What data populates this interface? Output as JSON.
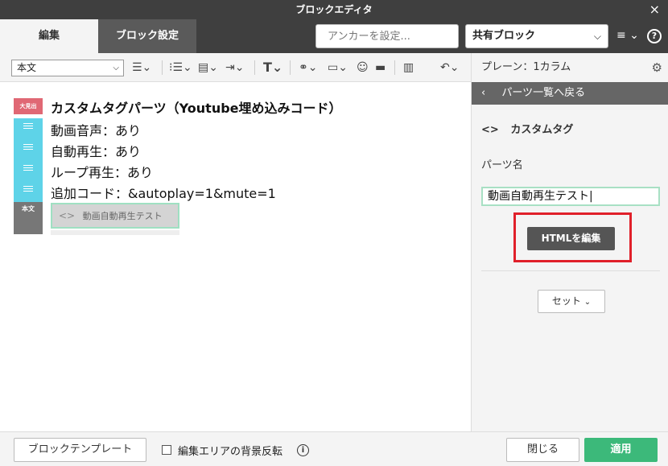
{
  "window": {
    "title": "ブロックエディタ",
    "close_icon": "×"
  },
  "header": {
    "tabs": [
      {
        "label": "編集"
      },
      {
        "label": "ブロック設定"
      }
    ],
    "anchor_placeholder": "アンカーを設定...",
    "share_select": "共有ブロック",
    "menu_icon": "≡",
    "help_icon": "?"
  },
  "toolbar": {
    "style_select": "本文",
    "icons": [
      "align-left-icon",
      "list-icon",
      "block-icon",
      "indent-icon",
      "text-style-icon",
      "link-icon",
      "image-icon",
      "emoji-icon",
      "hr-icon",
      "split-icon",
      "undo-icon"
    ]
  },
  "canvas": {
    "heading_tag": "大見出",
    "heading": "カスタムタグパーツ（Youtube埋め込みコード）",
    "lines": [
      "動画音声：あり",
      "自動再生：あり",
      "ループ再生：あり",
      "追加コード：&autoplay=1&mute=1"
    ],
    "body_tag": "本文",
    "custom_part_label": "動画自動再生テスト"
  },
  "panel": {
    "layout_label": "プレーン：1カラム",
    "back_label": "パーツ一覧へ戻る",
    "custom_tag_title": "カスタムタグ",
    "part_name_label": "パーツ名",
    "part_name_value": "動画自動再生テスト",
    "html_edit_button": "HTMLを編集",
    "set_button": "セット"
  },
  "footer": {
    "template_button": "ブロックテンプレート",
    "invert_bg_label": "編集エリアの背景反転",
    "close_button": "閉じる",
    "apply_button": "適用"
  },
  "colors": {
    "accent_green": "#3cb97a",
    "heading_tag": "#e06874",
    "paragraph_tag": "#5ed3e8",
    "highlight_red": "#e0202a"
  }
}
